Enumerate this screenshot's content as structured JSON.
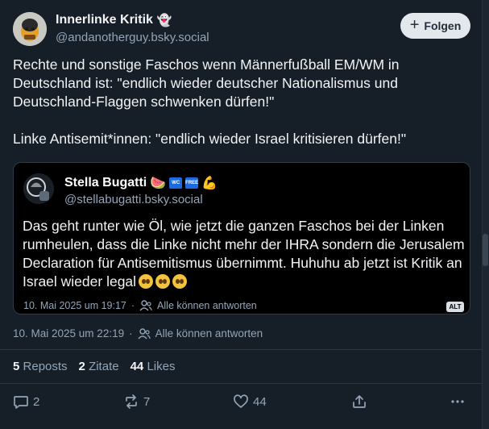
{
  "author": {
    "name": "Innerlinke Kritik",
    "name_emoji": "👻",
    "handle": "@andanotherguy.bsky.social"
  },
  "follow_button": {
    "label": "Folgen",
    "icon": "plus-icon"
  },
  "post_text": "Rechte und sonstige Faschos wenn Männerfußball EM/WM in Deutschland ist: \"endlich wieder deutscher Nationalismus und Deutschland-Flaggen schwenken dürfen!\"\n\nLinke Antisemit*innen: \"endlich wieder Israel kritisieren dürfen!\"",
  "quote": {
    "name": "Stella Bugatti",
    "name_emojis": [
      "🍉",
      "WC",
      "FREE",
      "💪"
    ],
    "handle": "@stellabugatti.bsky.social",
    "text": "Das geht runter wie Öl, wie jetzt die ganzen Faschos bei der Linken rumheulen, dass die Linke nicht mehr der IHRA sondern die Jerusalem Declaration für Antisemitismus übernimmt. Huhuhu ab jetzt ist Kritik an Israel wieder legal",
    "date": "10. Mai 2025 um 19:17",
    "separator": "·",
    "reply_setting": "Alle können antworten",
    "alt_label": "ALT"
  },
  "meta": {
    "date": "10. Mai 2025 um 22:19",
    "separator": "·",
    "reply_setting": "Alle können antworten"
  },
  "stats": {
    "reposts_count": "5",
    "reposts_label": "Reposts",
    "quotes_count": "2",
    "quotes_label": "Zitate",
    "likes_count": "44",
    "likes_label": "Likes"
  },
  "actions": {
    "reply_count": "2",
    "repost_count": "7",
    "like_count": "44"
  },
  "colors": {
    "background": "#161e27",
    "text": "#f1f3f5",
    "muted": "#93a5b7",
    "quote_background": "#000000",
    "button_background": "#e3e8ed"
  }
}
